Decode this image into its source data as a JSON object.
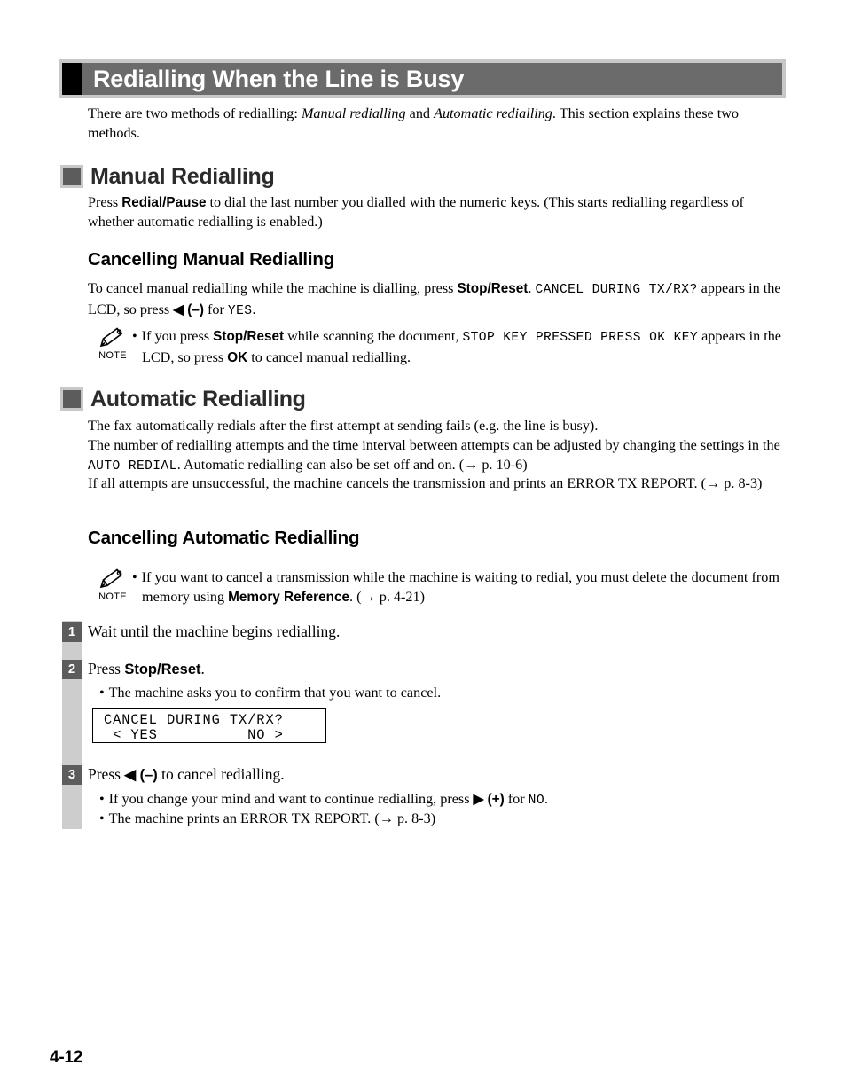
{
  "page": {
    "title": "Redialling When the Line is Busy",
    "footer_page_number": "4-12",
    "colors": {
      "title_band": "#6b6b6b",
      "title_frame": "#c8c8c8",
      "title_square": "#000000",
      "heading_bullet": "#5c5c5c",
      "step_bar": "#cdcdcd",
      "step_number_box": "#5c5c5c"
    }
  },
  "intro": {
    "text_1": "There are two methods of redialling: ",
    "italic_1": "Manual redialling",
    "text_2": " and ",
    "italic_2": "Automatic redialling",
    "text_3": ". This section explains these two methods."
  },
  "manual": {
    "heading": "Manual Redialling",
    "para_1": "Press ",
    "kbd_1": "Redial/Pause",
    "para_2": " to dial the last number you dialled with the numeric keys. (This starts redialling regardless of whether automatic redialling is enabled.)",
    "sub_heading": "Cancelling Manual Redialling",
    "cancel_1": "To cancel manual redialling while the machine is dialling, press ",
    "cancel_kbd": "Stop/Reset",
    "cancel_2": ". ",
    "cancel_lcd": "CANCEL DURING TX/RX?",
    "cancel_3": " appears in the LCD, so press ",
    "cancel_arrow": "◀ (–)",
    "cancel_4": " for ",
    "cancel_yes": "YES",
    "cancel_5": ".",
    "note": {
      "icon_label": "NOTE",
      "bullet": "•",
      "text_1": "If you press ",
      "kbd_1": "Stop/Reset",
      "text_2": " while scanning the document, ",
      "lcd_1": "STOP KEY PRESSED PRESS OK KEY",
      "text_3": " appears in the LCD, so press ",
      "kbd_2": "OK",
      "text_4": " to cancel manual redialling."
    }
  },
  "automatic": {
    "heading": "Automatic Redialling",
    "line_1": "The fax automatically redials after the first attempt at sending fails (e.g. the line is busy).",
    "line_2": "The number of redialling attempts and the time interval between attempts can be adjusted by changing the settings in the ",
    "line_2_lcd": "AUTO REDIAL",
    "line_2_cont": ". Automatic redialling can also be set off and on. (→ p. 10-6)",
    "line_3": "If all attempts are unsuccessful, the machine cancels the transmission and prints an ERROR TX REPORT. (→ p. 8-3)",
    "sub_heading": "Cancelling Automatic Redialling",
    "note": {
      "icon_label": "NOTE",
      "bullet": "•",
      "text_1": "If you want to cancel a transmission while the machine is waiting to redial, you must delete the document from memory using ",
      "kbd_1": "Memory Reference",
      "text_2": ". (→ p. 4-21)"
    }
  },
  "steps": [
    {
      "number": "1",
      "text": "Wait until the machine begins redialling."
    },
    {
      "number": "2",
      "text_1": "Press ",
      "kbd_1": "Stop/Reset",
      "text_2": ".",
      "sub_bullet": "•",
      "sub_text": "The machine asks you to confirm that you want to cancel."
    },
    {
      "number": "3",
      "text_1": "Press ",
      "arrow": "◀ (–)",
      "text_2": " to cancel redialling.",
      "sub_1_bullet": "•",
      "sub_1_text_a": "If you change your mind and want to continue redialling, press ",
      "sub_1_arrow": "▶ (+)",
      "sub_1_text_b": " for ",
      "sub_1_lcd": "NO",
      "sub_1_text_c": ".",
      "sub_2_bullet": "•",
      "sub_2_text": "The machine prints an ERROR TX REPORT. (→ p. 8-3)"
    }
  ],
  "lcd_display": {
    "line_1": "CANCEL DURING TX/RX?",
    "line_2": " < YES          NO >"
  }
}
